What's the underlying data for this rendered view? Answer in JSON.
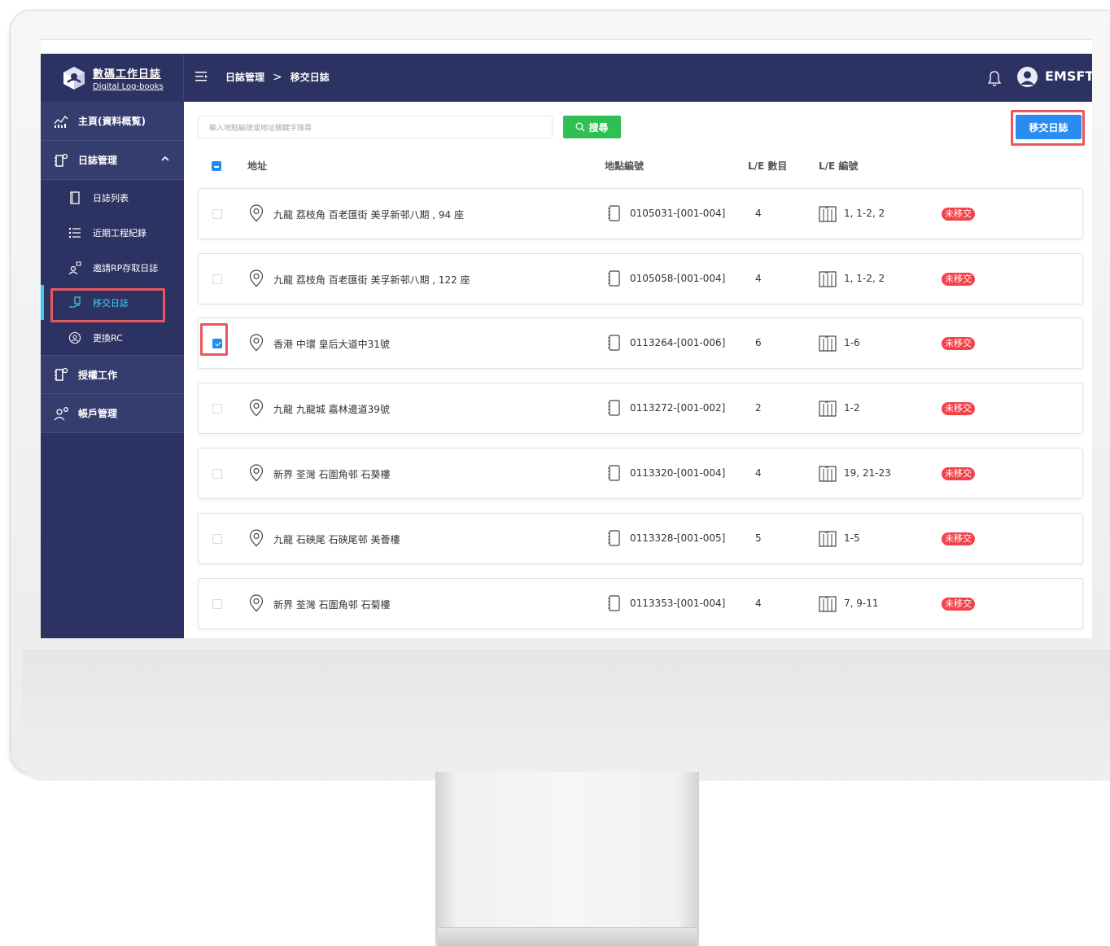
{
  "app": {
    "title": "數碼工作日誌",
    "subtitle": "Digital Log-books",
    "username": "EMSFT"
  },
  "breadcrumb": {
    "parent": "日誌管理",
    "separator": ">",
    "current": "移交日誌"
  },
  "sidebar": {
    "items": [
      {
        "label": "主頁(資料概覧)",
        "icon": "dashboard-chart-icon"
      },
      {
        "label": "日誌管理",
        "icon": "logbook-icon",
        "expanded": true,
        "children": [
          {
            "label": "日誌列表",
            "icon": "book-icon"
          },
          {
            "label": "近期工程紀錄",
            "icon": "list-icon"
          },
          {
            "label": "邀請RP存取日誌",
            "icon": "invite-user-icon"
          },
          {
            "label": "移交日誌",
            "icon": "handover-icon",
            "active": true
          },
          {
            "label": "更換RC",
            "icon": "swap-user-icon"
          }
        ]
      },
      {
        "label": "授權工作",
        "icon": "logbook-icon"
      },
      {
        "label": "帳戶管理",
        "icon": "account-icon"
      }
    ]
  },
  "search": {
    "placeholder": "輸入地點編號或地址關鍵字搜尋",
    "button_label": "搜尋"
  },
  "actions": {
    "transfer_label": "移交日誌"
  },
  "table": {
    "headers": {
      "address": "地址",
      "location_code": "地點編號",
      "le_count": "L/E 數目",
      "le_number": "L/E 編號"
    },
    "rows": [
      {
        "address": "九龍 荔枝角 百老匯街 美孚新邨八期 , 94 座",
        "code": "0105031-[001-004]",
        "count": "4",
        "le": "1, 1-2, 2",
        "status": "未移交",
        "checked": false
      },
      {
        "address": "九龍 荔枝角 百老匯街 美孚新邨八期 , 122 座",
        "code": "0105058-[001-004]",
        "count": "4",
        "le": "1, 1-2, 2",
        "status": "未移交",
        "checked": false
      },
      {
        "address": "香港 中環 皇后大道中31號",
        "code": "0113264-[001-006]",
        "count": "6",
        "le": "1-6",
        "status": "未移交",
        "checked": true
      },
      {
        "address": "九龍 九龍城 嘉林邊道39號",
        "code": "0113272-[001-002]",
        "count": "2",
        "le": "1-2",
        "status": "未移交",
        "checked": false
      },
      {
        "address": "新界 荃灣 石圍角邨 石葵樓",
        "code": "0113320-[001-004]",
        "count": "4",
        "le": "19, 21-23",
        "status": "未移交",
        "checked": false
      },
      {
        "address": "九龍 石硤尾 石硤尾邨 美薈樓",
        "code": "0113328-[001-005]",
        "count": "5",
        "le": "1-5",
        "status": "未移交",
        "checked": false
      },
      {
        "address": "新界 荃灣 石圍角邨 石菊樓",
        "code": "0113353-[001-004]",
        "count": "4",
        "le": "7, 9-11",
        "status": "未移交",
        "checked": false
      }
    ]
  },
  "colors": {
    "nav_bg": "#2c3261",
    "accent_blue": "#2a8bf0",
    "search_green": "#2fbf52",
    "status_red": "#f2424a",
    "highlight_red": "#e8575e",
    "active_cyan": "#3fd0ef"
  }
}
